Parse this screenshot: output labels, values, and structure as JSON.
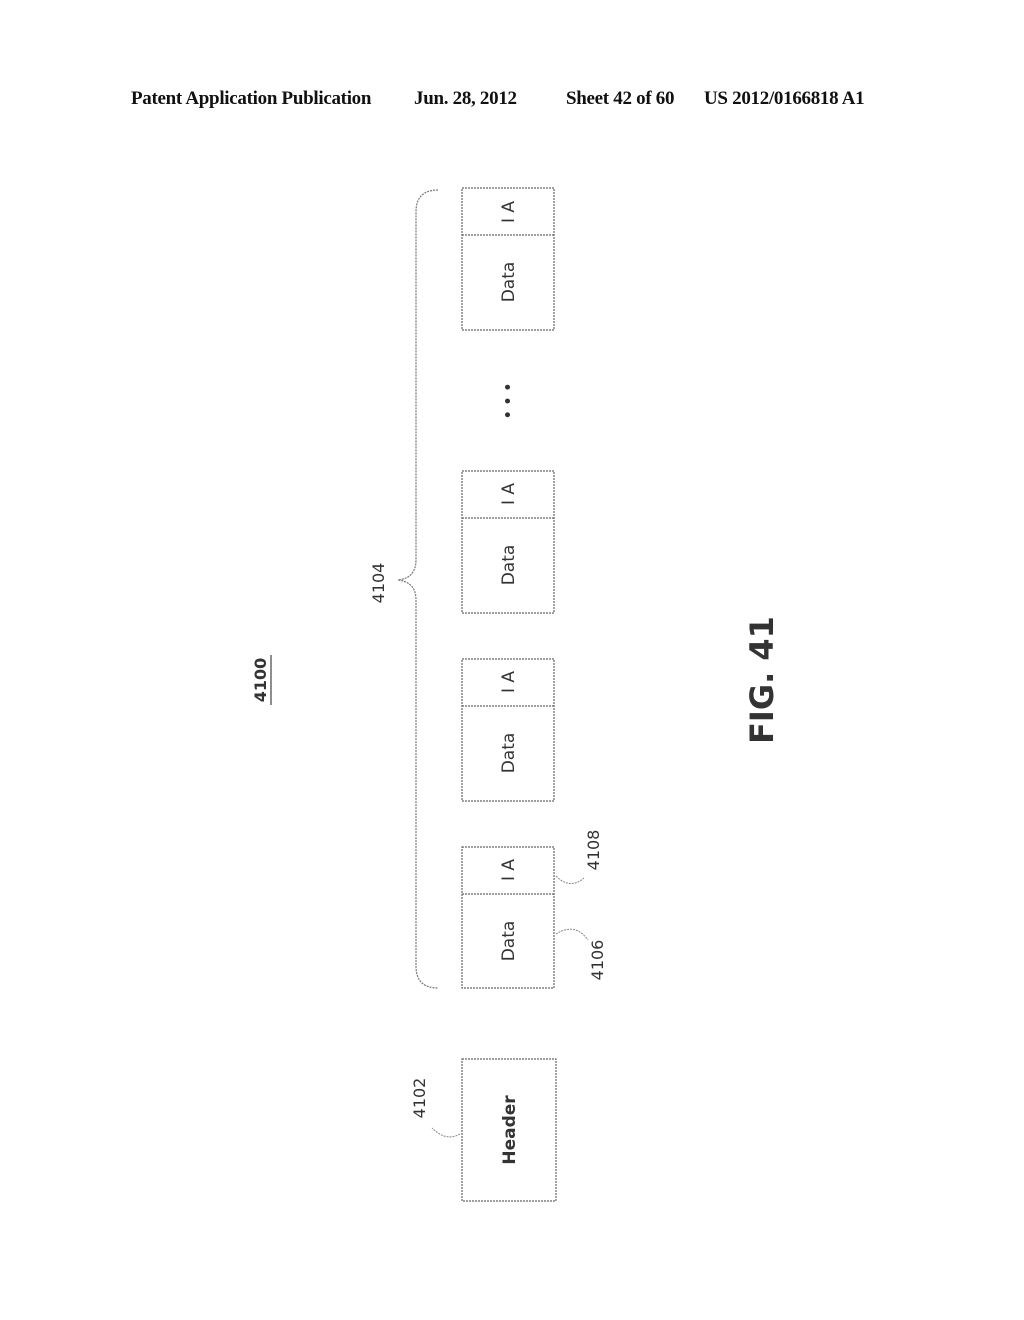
{
  "header": {
    "publication_label": "Patent Application Publication",
    "date": "Jun. 28, 2012",
    "sheet": "Sheet 42 of 60",
    "publication_number": "US 2012/0166818 A1"
  },
  "figure": {
    "caption": "FIG. 41",
    "figure_ref": "4100",
    "header_block": {
      "label": "Header",
      "ref": "4102"
    },
    "packet_group_ref": "4104",
    "data_ref": "4106",
    "ia_ref": "4108",
    "ellipsis": "• • •",
    "packets": [
      {
        "data_label": "Data",
        "ia_label": "I A"
      },
      {
        "data_label": "Data",
        "ia_label": "I A"
      },
      {
        "data_label": "Data",
        "ia_label": "I A"
      },
      {
        "data_label": "Data",
        "ia_label": "I A"
      }
    ]
  }
}
